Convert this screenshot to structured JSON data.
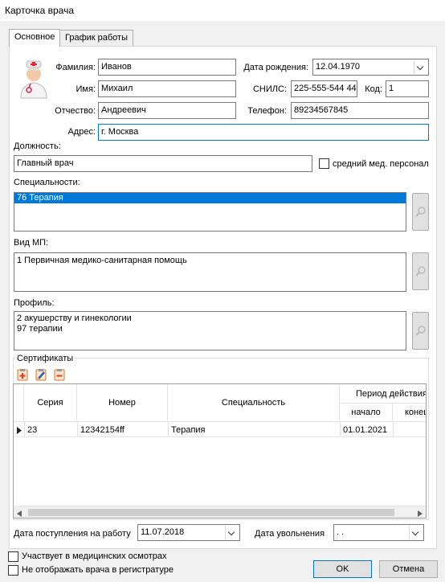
{
  "window": {
    "title": "Карточка врача"
  },
  "tabs": [
    "Основное",
    "График работы"
  ],
  "form": {
    "surname_label": "Фамилия:",
    "surname": "Иванов",
    "name_label": "Имя:",
    "name": "Михаил",
    "patronymic_label": "Отчество:",
    "patronymic": "Андреевич",
    "address_label": "Адрес:",
    "address": "г. Москва",
    "birth_label": "Дата рождения:",
    "birth": "12.04.1970",
    "snils_label": "СНИЛС:",
    "snils": "225-555-544 44",
    "code_label": "Код:",
    "code": "1",
    "phone_label": "Телефон:",
    "phone": "89234567845",
    "position_label": "Должность:",
    "position": "Главный врач",
    "middle_staff_label": "средний мед. персонал",
    "specialties_label": "Специальности:",
    "specialties": [
      "76 Терапия"
    ],
    "mp_type_label": "Вид МП:",
    "mp_types": [
      "1 Первичная медико-санитарная помощь"
    ],
    "profile_label": "Профиль:",
    "profiles": [
      "2 акушерству и гинекологии",
      "97 терапии"
    ]
  },
  "certificates": {
    "title": "Сертификаты",
    "columns": {
      "series": "Серия",
      "number": "Номер",
      "specialty": "Специальность",
      "period": "Период действия",
      "start": "начало",
      "end": "конец"
    },
    "rows": [
      {
        "series": "23",
        "number": "12342154ff",
        "specialty": "Терапия",
        "start": "01.01.2021",
        "end": ""
      }
    ]
  },
  "dates": {
    "hire_label": "Дата поступления на работу",
    "hire": "11.07.2018",
    "fire_label": "Дата увольнения",
    "fire": " .  ."
  },
  "options": {
    "medical_checkups": "Участвует в медицинских осмотрах",
    "hide_in_registry": "Не отображать врача в регистратуре"
  },
  "buttons": {
    "ok": "OK",
    "cancel": "Отмена"
  },
  "colors": {
    "accent": "#0078d7",
    "selection": "#0078d7"
  }
}
